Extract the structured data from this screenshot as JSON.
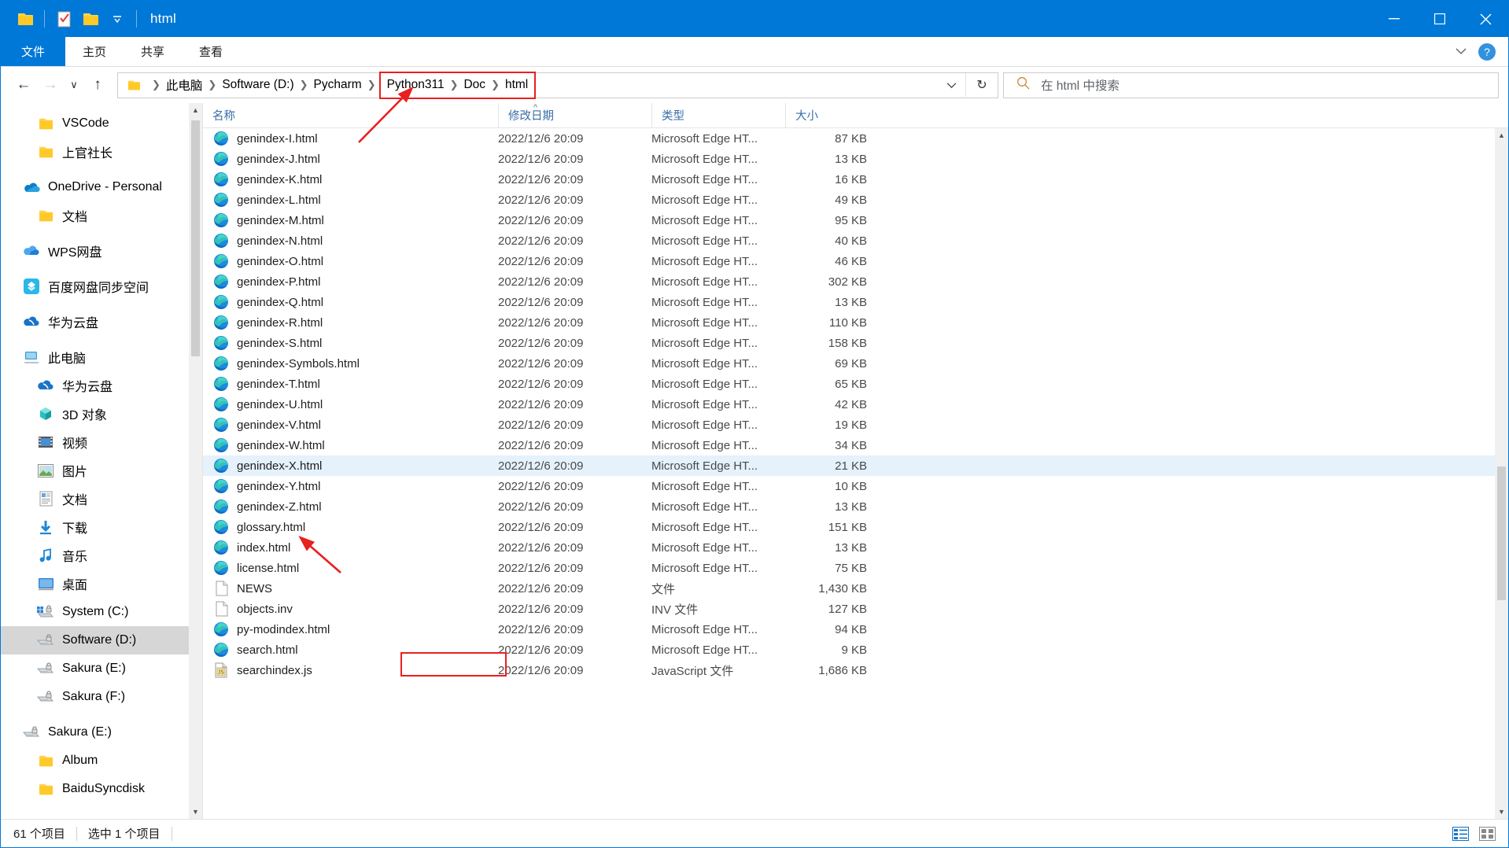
{
  "window": {
    "title": "html",
    "quick_access": [
      "folder-icon",
      "properties-icon",
      "new-folder-icon",
      "customize-chevron-icon"
    ],
    "minimize_label": "—",
    "maximize_label": "☐",
    "close_label": "✕"
  },
  "ribbon": {
    "tabs": [
      {
        "label": "文件",
        "active": true
      },
      {
        "label": "主页",
        "active": false
      },
      {
        "label": "共享",
        "active": false
      },
      {
        "label": "查看",
        "active": false
      }
    ],
    "collapse_icon": "chevron-down-icon",
    "help_label": "?"
  },
  "address": {
    "back_label": "←",
    "forward_label": "→",
    "recent_label": "∨",
    "up_label": "↑",
    "crumbs": [
      {
        "label": "此电脑",
        "highlighted": false
      },
      {
        "label": "Software (D:)",
        "highlighted": false
      },
      {
        "label": "Pycharm",
        "highlighted": false
      },
      {
        "label": "Python311",
        "highlighted": true
      },
      {
        "label": "Doc",
        "highlighted": true
      },
      {
        "label": "html",
        "highlighted": true
      }
    ],
    "dropdown_label": "∨",
    "refresh_label": "↻"
  },
  "search": {
    "placeholder": "在 html 中搜索",
    "icon": "search-icon"
  },
  "sidebar": {
    "items": [
      {
        "label": "VSCode",
        "icon": "folder-icon",
        "indent": 2,
        "selected": false
      },
      {
        "label": "上官社长",
        "icon": "folder-icon",
        "indent": 2,
        "selected": false
      },
      {
        "label": "",
        "icon": "gap",
        "indent": 0,
        "selected": false
      },
      {
        "label": "OneDrive - Personal",
        "icon": "onedrive-icon",
        "indent": 1,
        "selected": false
      },
      {
        "label": "文档",
        "icon": "folder-icon",
        "indent": 2,
        "selected": false
      },
      {
        "label": "",
        "icon": "gap",
        "indent": 0,
        "selected": false
      },
      {
        "label": "WPS网盘",
        "icon": "wps-cloud-icon",
        "indent": 1,
        "selected": false
      },
      {
        "label": "",
        "icon": "gap",
        "indent": 0,
        "selected": false
      },
      {
        "label": "百度网盘同步空间",
        "icon": "baidu-netdisk-icon",
        "indent": 1,
        "selected": false
      },
      {
        "label": "",
        "icon": "gap",
        "indent": 0,
        "selected": false
      },
      {
        "label": "华为云盘",
        "icon": "huawei-cloud-icon",
        "indent": 1,
        "selected": false
      },
      {
        "label": "",
        "icon": "gap",
        "indent": 0,
        "selected": false
      },
      {
        "label": "此电脑",
        "icon": "this-pc-icon",
        "indent": 1,
        "selected": false
      },
      {
        "label": "华为云盘",
        "icon": "huawei-cloud-icon",
        "indent": 2,
        "selected": false
      },
      {
        "label": "3D 对象",
        "icon": "3d-objects-icon",
        "indent": 2,
        "selected": false
      },
      {
        "label": "视频",
        "icon": "videos-icon",
        "indent": 2,
        "selected": false
      },
      {
        "label": "图片",
        "icon": "pictures-icon",
        "indent": 2,
        "selected": false
      },
      {
        "label": "文档",
        "icon": "documents-icon",
        "indent": 2,
        "selected": false
      },
      {
        "label": "下载",
        "icon": "downloads-icon",
        "indent": 2,
        "selected": false
      },
      {
        "label": "音乐",
        "icon": "music-icon",
        "indent": 2,
        "selected": false
      },
      {
        "label": "桌面",
        "icon": "desktop-icon",
        "indent": 2,
        "selected": false
      },
      {
        "label": "System (C:)",
        "icon": "system-drive-icon",
        "indent": 2,
        "selected": false
      },
      {
        "label": "Software (D:)",
        "icon": "drive-icon",
        "indent": 2,
        "selected": true
      },
      {
        "label": "Sakura (E:)",
        "icon": "drive-icon",
        "indent": 2,
        "selected": false
      },
      {
        "label": "Sakura (F:)",
        "icon": "drive-icon",
        "indent": 2,
        "selected": false
      },
      {
        "label": "",
        "icon": "gap",
        "indent": 0,
        "selected": false
      },
      {
        "label": "Sakura (E:)",
        "icon": "drive-icon",
        "indent": 1,
        "selected": false
      },
      {
        "label": "Album",
        "icon": "folder-icon",
        "indent": 2,
        "selected": false
      },
      {
        "label": "BaiduSyncdisk",
        "icon": "folder-icon",
        "indent": 2,
        "selected": false
      }
    ]
  },
  "filelist": {
    "columns": [
      {
        "key": "name",
        "label": "名称"
      },
      {
        "key": "date",
        "label": "修改日期"
      },
      {
        "key": "type",
        "label": "类型"
      },
      {
        "key": "size",
        "label": "大小"
      }
    ],
    "sort_indicator": "^",
    "rows": [
      {
        "name": "genindex-I.html",
        "date": "2022/12/6 20:09",
        "type": "Microsoft Edge HT...",
        "size": "87 KB",
        "icon": "edge-icon",
        "selected": false
      },
      {
        "name": "genindex-J.html",
        "date": "2022/12/6 20:09",
        "type": "Microsoft Edge HT...",
        "size": "13 KB",
        "icon": "edge-icon",
        "selected": false
      },
      {
        "name": "genindex-K.html",
        "date": "2022/12/6 20:09",
        "type": "Microsoft Edge HT...",
        "size": "16 KB",
        "icon": "edge-icon",
        "selected": false
      },
      {
        "name": "genindex-L.html",
        "date": "2022/12/6 20:09",
        "type": "Microsoft Edge HT...",
        "size": "49 KB",
        "icon": "edge-icon",
        "selected": false
      },
      {
        "name": "genindex-M.html",
        "date": "2022/12/6 20:09",
        "type": "Microsoft Edge HT...",
        "size": "95 KB",
        "icon": "edge-icon",
        "selected": false
      },
      {
        "name": "genindex-N.html",
        "date": "2022/12/6 20:09",
        "type": "Microsoft Edge HT...",
        "size": "40 KB",
        "icon": "edge-icon",
        "selected": false
      },
      {
        "name": "genindex-O.html",
        "date": "2022/12/6 20:09",
        "type": "Microsoft Edge HT...",
        "size": "46 KB",
        "icon": "edge-icon",
        "selected": false
      },
      {
        "name": "genindex-P.html",
        "date": "2022/12/6 20:09",
        "type": "Microsoft Edge HT...",
        "size": "302 KB",
        "icon": "edge-icon",
        "selected": false
      },
      {
        "name": "genindex-Q.html",
        "date": "2022/12/6 20:09",
        "type": "Microsoft Edge HT...",
        "size": "13 KB",
        "icon": "edge-icon",
        "selected": false
      },
      {
        "name": "genindex-R.html",
        "date": "2022/12/6 20:09",
        "type": "Microsoft Edge HT...",
        "size": "110 KB",
        "icon": "edge-icon",
        "selected": false
      },
      {
        "name": "genindex-S.html",
        "date": "2022/12/6 20:09",
        "type": "Microsoft Edge HT...",
        "size": "158 KB",
        "icon": "edge-icon",
        "selected": false
      },
      {
        "name": "genindex-Symbols.html",
        "date": "2022/12/6 20:09",
        "type": "Microsoft Edge HT...",
        "size": "69 KB",
        "icon": "edge-icon",
        "selected": false
      },
      {
        "name": "genindex-T.html",
        "date": "2022/12/6 20:09",
        "type": "Microsoft Edge HT...",
        "size": "65 KB",
        "icon": "edge-icon",
        "selected": false
      },
      {
        "name": "genindex-U.html",
        "date": "2022/12/6 20:09",
        "type": "Microsoft Edge HT...",
        "size": "42 KB",
        "icon": "edge-icon",
        "selected": false
      },
      {
        "name": "genindex-V.html",
        "date": "2022/12/6 20:09",
        "type": "Microsoft Edge HT...",
        "size": "19 KB",
        "icon": "edge-icon",
        "selected": false
      },
      {
        "name": "genindex-W.html",
        "date": "2022/12/6 20:09",
        "type": "Microsoft Edge HT...",
        "size": "34 KB",
        "icon": "edge-icon",
        "selected": false
      },
      {
        "name": "genindex-X.html",
        "date": "2022/12/6 20:09",
        "type": "Microsoft Edge HT...",
        "size": "21 KB",
        "icon": "edge-icon",
        "selected": true
      },
      {
        "name": "genindex-Y.html",
        "date": "2022/12/6 20:09",
        "type": "Microsoft Edge HT...",
        "size": "10 KB",
        "icon": "edge-icon",
        "selected": false
      },
      {
        "name": "genindex-Z.html",
        "date": "2022/12/6 20:09",
        "type": "Microsoft Edge HT...",
        "size": "13 KB",
        "icon": "edge-icon",
        "selected": false
      },
      {
        "name": "glossary.html",
        "date": "2022/12/6 20:09",
        "type": "Microsoft Edge HT...",
        "size": "151 KB",
        "icon": "edge-icon",
        "selected": false
      },
      {
        "name": "index.html",
        "date": "2022/12/6 20:09",
        "type": "Microsoft Edge HT...",
        "size": "13 KB",
        "icon": "edge-icon",
        "selected": false
      },
      {
        "name": "license.html",
        "date": "2022/12/6 20:09",
        "type": "Microsoft Edge HT...",
        "size": "75 KB",
        "icon": "edge-icon",
        "selected": false
      },
      {
        "name": "NEWS",
        "date": "2022/12/6 20:09",
        "type": "文件",
        "size": "1,430 KB",
        "icon": "generic-file-icon",
        "selected": false
      },
      {
        "name": "objects.inv",
        "date": "2022/12/6 20:09",
        "type": "INV 文件",
        "size": "127 KB",
        "icon": "generic-file-icon",
        "selected": false
      },
      {
        "name": "py-modindex.html",
        "date": "2022/12/6 20:09",
        "type": "Microsoft Edge HT...",
        "size": "94 KB",
        "icon": "edge-icon",
        "selected": false
      },
      {
        "name": "search.html",
        "date": "2022/12/6 20:09",
        "type": "Microsoft Edge HT...",
        "size": "9 KB",
        "icon": "edge-icon",
        "selected": false
      },
      {
        "name": "searchindex.js",
        "date": "2022/12/6 20:09",
        "type": "JavaScript 文件",
        "size": "1,686 KB",
        "icon": "js-file-icon",
        "selected": false
      }
    ]
  },
  "statusbar": {
    "item_count": "61 个项目",
    "selection": "选中 1 个项目",
    "view_details_icon": "details-view-icon",
    "view_large_icon": "large-icons-view-icon"
  },
  "annotations": {
    "accent_red": "#e8201f",
    "highlighted_crumb_box": "Python311 > Doc > html",
    "highlighted_file_box": "index.html"
  }
}
